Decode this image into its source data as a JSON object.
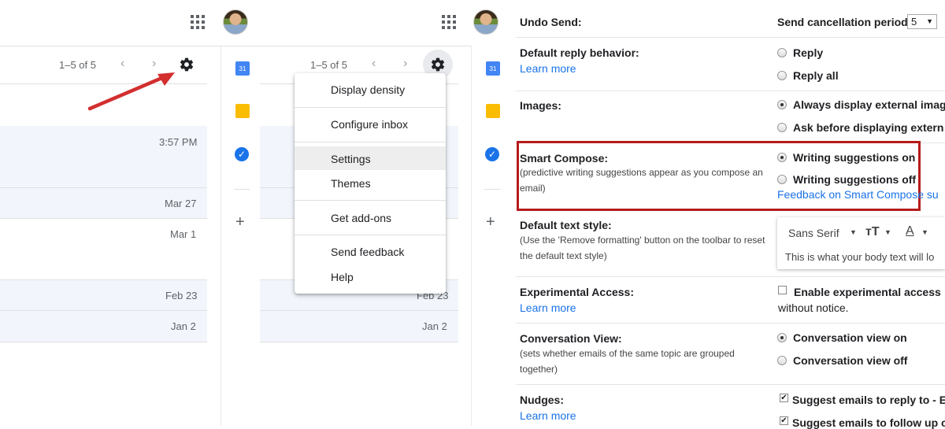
{
  "pane1": {
    "pager": "1–5 of 5",
    "dates": [
      "3:57 PM",
      "Mar 27",
      "Mar 1",
      "Feb 23",
      "Jan 2"
    ]
  },
  "pane2": {
    "pager": "1–5 of 5",
    "dates": [
      "Feb 23",
      "Jan 2"
    ]
  },
  "menu": {
    "items": [
      "Display density",
      "Configure inbox",
      "Settings",
      "Themes",
      "Get add-ons",
      "Send feedback",
      "Help"
    ]
  },
  "settings": {
    "undo_send": {
      "label": "Undo Send:",
      "period_label": "Send cancellation period:",
      "period_value": "5"
    },
    "reply": {
      "label": "Default reply behavior:",
      "link": "Learn more",
      "options": [
        "Reply",
        "Reply all"
      ]
    },
    "images": {
      "label": "Images:",
      "options": [
        "Always display external imag",
        "Ask before displaying extern"
      ]
    },
    "smart_compose": {
      "label": "Smart Compose:",
      "desc": "(predictive writing suggestions appear as you compose an email)",
      "options": [
        "Writing suggestions on",
        "Writing suggestions off"
      ],
      "feedback_link": "Feedback on Smart Compose su"
    },
    "text_style": {
      "label": "Default text style:",
      "desc": "(Use the 'Remove formatting' button on the toolbar to reset the default text style)",
      "font": "Sans Serif",
      "preview": "This is what your body text will lo"
    },
    "experimental": {
      "label": "Experimental Access:",
      "link": "Learn more",
      "option": "Enable experimental access",
      "option_cont": "without notice."
    },
    "conversation": {
      "label": "Conversation View:",
      "desc": "(sets whether emails of the same topic are grouped together)",
      "options": [
        "Conversation view on",
        "Conversation view off"
      ]
    },
    "nudges": {
      "label": "Nudges:",
      "link": "Learn more",
      "options": [
        "Suggest emails to reply to - E",
        "Suggest emails to follow up o"
      ]
    }
  },
  "colors": {
    "accent": "#1a73e8",
    "highlight_box": "#b71c1c",
    "arrow": "#d32f2f"
  }
}
